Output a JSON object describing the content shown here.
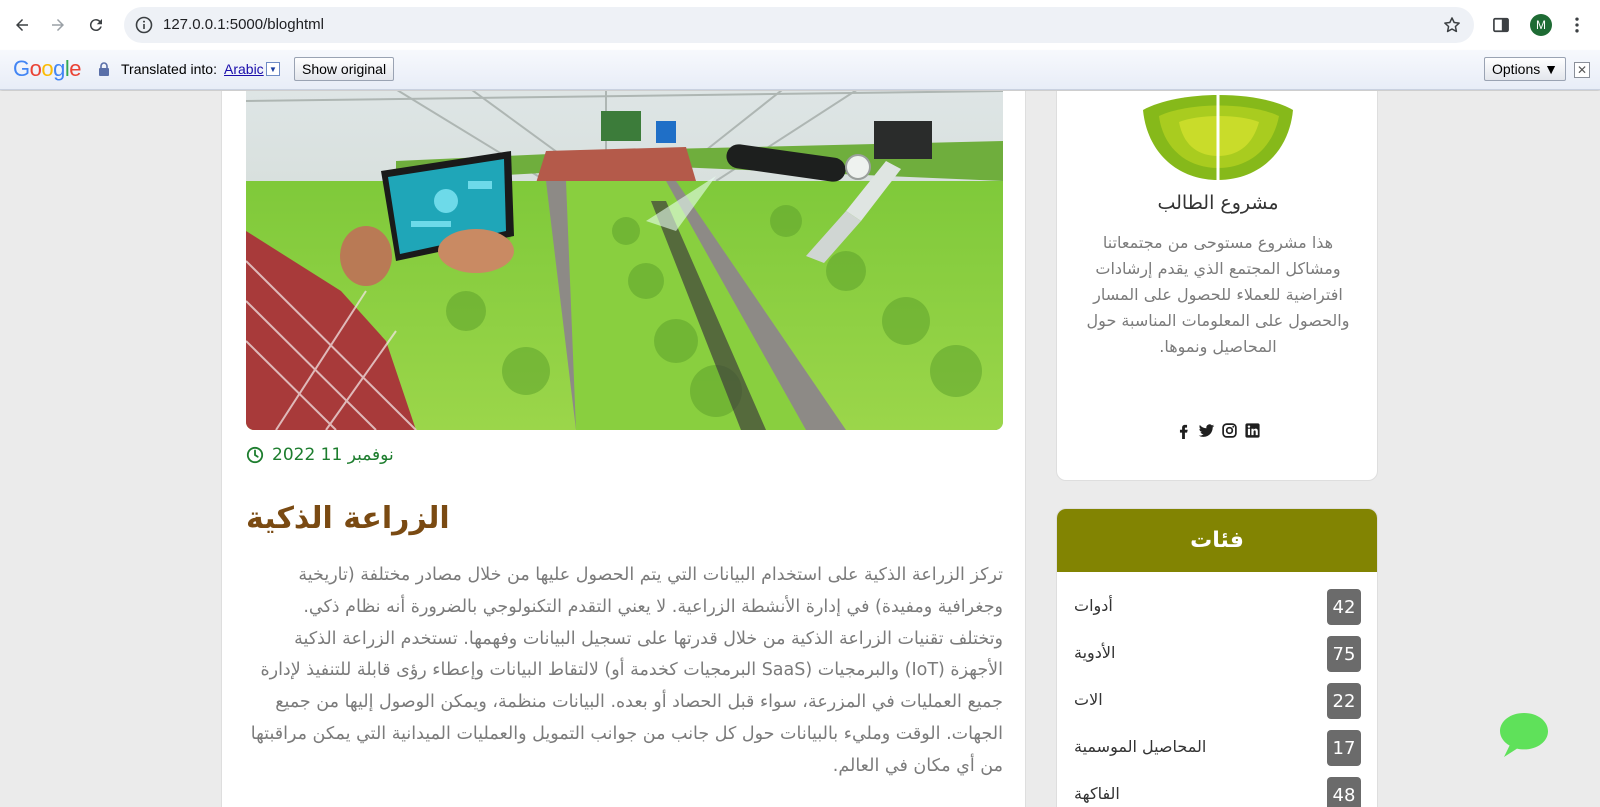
{
  "browser": {
    "url": "127.0.0.1:5000/bloghtml",
    "profile_initial": "M"
  },
  "translate_bar": {
    "logo_text": "Google",
    "translated_into": "Translated into:",
    "language": "Arabic",
    "show_original": "Show original",
    "options": "Options ▼",
    "close": "✕"
  },
  "post": {
    "date": "نوفمبر 11 2022",
    "title": "الزراعة الذكية",
    "body": "تركز الزراعة الذكية على استخدام البيانات التي يتم الحصول عليها من خلال مصادر مختلفة (تاريخية وجغرافية ومفيدة) في إدارة الأنشطة الزراعية. لا يعني التقدم التكنولوجي بالضرورة أنه نظام ذكي. وتختلف تقنيات الزراعة الذكية من خلال قدرتها على تسجيل البيانات وفهمها. تستخدم الزراعة الذكية الأجهزة (IoT) والبرمجيات (SaaS البرمجيات كخدمة أو) لالتقاط البيانات وإعطاء رؤى قابلة للتنفيذ لإدارة جميع العمليات في المزرعة، سواء قبل الحصاد أو بعده. البيانات منظمة، ويمكن الوصول إليها من جميع الجهات. الوقت ومليء بالبيانات حول كل جانب من جوانب التمويل والعمليات الميدانية التي يمكن مراقبتها من أي مكان في العالم."
  },
  "sidebar": {
    "title": "مشروع الطالب",
    "description": "هذا مشروع مستوحى من مجتمعاتنا ومشاكل المجتمع الذي يقدم إرشادات افتراضية للعملاء للحصول على المسار والحصول على المعلومات المناسبة حول المحاصيل ونموها."
  },
  "categories": {
    "heading": "فئات",
    "items": [
      {
        "label": "أدوات",
        "count": "42"
      },
      {
        "label": "الأدوية",
        "count": "75"
      },
      {
        "label": "الات",
        "count": "22"
      },
      {
        "label": "المحاصيل الموسمية",
        "count": "17"
      },
      {
        "label": "الفاكهة",
        "count": "48"
      }
    ]
  },
  "colors": {
    "accent_olive": "#828402",
    "date_green": "#1d7d2e",
    "title_brown": "#7a4a12",
    "chat_green": "#5fe15a"
  }
}
